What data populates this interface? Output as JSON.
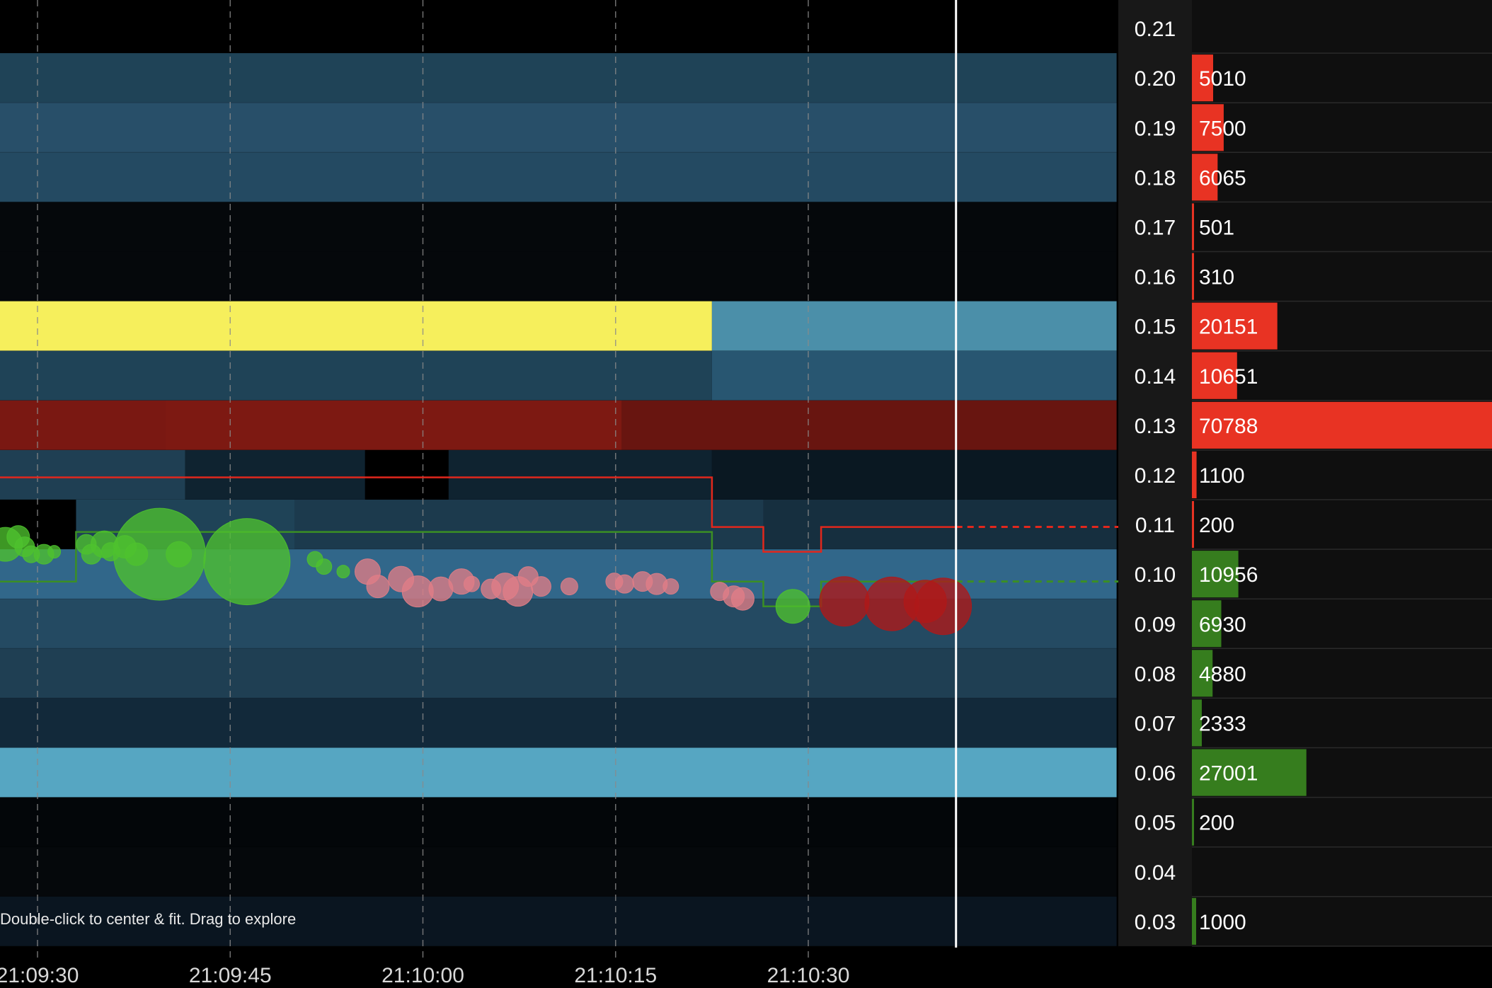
{
  "hint_text": "Double-click to center & fit. Drag to explore",
  "colors": {
    "background": "#000000",
    "price_column": "#181818",
    "volume_panel": "#0f0f0f",
    "ask_bar": "#e83323",
    "bid_bar": "#367d1e",
    "best_bid_line": "#3b8f24",
    "best_ask_line": "#e2271c",
    "buy_trade": "#4ec22e",
    "sell_trade": "#e07d86",
    "large_sell_trade": "#b01818",
    "grid": "#8a8a8a",
    "cursor_line": "#ffffff"
  },
  "chart_data": {
    "type": "heatmap",
    "title": "",
    "xlabel": "",
    "ylabel": "",
    "x_ticks": [
      "21:09:30",
      "21:09:45",
      "21:10:00",
      "21:10:15",
      "21:10:30"
    ],
    "x_tick_seconds": [
      0,
      15,
      30,
      45,
      60
    ],
    "xlim_seconds": [
      -3,
      84
    ],
    "cursor_seconds": 71.5,
    "price_levels": [
      0.21,
      0.2,
      0.19,
      0.18,
      0.17,
      0.16,
      0.15,
      0.14,
      0.13,
      0.12,
      0.11,
      0.1,
      0.09,
      0.08,
      0.07,
      0.06,
      0.05,
      0.04,
      0.03
    ],
    "price_labels": [
      "0.21",
      "0.20",
      "0.19",
      "0.18",
      "0.17",
      "0.16",
      "0.15",
      "0.14",
      "0.13",
      "0.12",
      "0.11",
      "0.10",
      "0.09",
      "0.08",
      "0.07",
      "0.06",
      "0.05",
      "0.04",
      "0.03"
    ],
    "depth_rows": [
      {
        "price": 0.21,
        "segments": []
      },
      {
        "price": 0.2,
        "segments": [
          {
            "from": -3,
            "to": 84,
            "color": "#1f4357"
          }
        ]
      },
      {
        "price": 0.19,
        "segments": [
          {
            "from": -3,
            "to": 84,
            "color": "#284f69"
          }
        ]
      },
      {
        "price": 0.18,
        "segments": [
          {
            "from": -3,
            "to": 84,
            "color": "#244a62"
          }
        ]
      },
      {
        "price": 0.17,
        "segments": [
          {
            "from": -3,
            "to": 84,
            "color": "#05080b"
          }
        ]
      },
      {
        "price": 0.16,
        "segments": [
          {
            "from": -3,
            "to": 84,
            "color": "#05080b"
          }
        ]
      },
      {
        "price": 0.15,
        "segments": [
          {
            "from": -3,
            "to": 52.5,
            "color": "#f6ef5c"
          },
          {
            "from": 52.5,
            "to": 84,
            "color": "#4b8fa9"
          }
        ]
      },
      {
        "price": 0.14,
        "segments": [
          {
            "from": -3,
            "to": 52.5,
            "color": "#1f4357"
          },
          {
            "from": 52.5,
            "to": 84,
            "color": "#285671"
          }
        ]
      },
      {
        "price": 0.13,
        "segments": [
          {
            "from": -3,
            "to": 10,
            "color": "#7a1812"
          },
          {
            "from": 10,
            "to": 45.5,
            "color": "#7d1912"
          },
          {
            "from": 45.5,
            "to": 84,
            "color": "#681510"
          }
        ]
      },
      {
        "price": 0.12,
        "segments": [
          {
            "from": -3,
            "to": 11.5,
            "color": "#1f3f53"
          },
          {
            "from": 11.5,
            "to": 25.5,
            "color": "#0f2330"
          },
          {
            "from": 25.5,
            "to": 32,
            "color": "#000000"
          },
          {
            "from": 32,
            "to": 52.5,
            "color": "#0f2330"
          },
          {
            "from": 52.5,
            "to": 84,
            "color": "#0a1822"
          }
        ]
      },
      {
        "price": 0.11,
        "segments": [
          {
            "from": -3,
            "to": 3,
            "color": "#000000"
          },
          {
            "from": 3,
            "to": 20,
            "color": "#1f4357"
          },
          {
            "from": 20,
            "to": 56.5,
            "color": "#1c3a4d"
          },
          {
            "from": 56.5,
            "to": 84,
            "color": "#162f3f"
          }
        ]
      },
      {
        "price": 0.1,
        "segments": [
          {
            "from": -3,
            "to": 84,
            "color": "#31678a"
          }
        ]
      },
      {
        "price": 0.09,
        "segments": [
          {
            "from": -3,
            "to": 84,
            "color": "#244a62"
          }
        ]
      },
      {
        "price": 0.08,
        "segments": [
          {
            "from": -3,
            "to": 84,
            "color": "#1f3f53"
          }
        ]
      },
      {
        "price": 0.07,
        "segments": [
          {
            "from": -3,
            "to": 84,
            "color": "#12293a"
          }
        ]
      },
      {
        "price": 0.06,
        "segments": [
          {
            "from": -3,
            "to": 84,
            "color": "#56a6c2"
          }
        ]
      },
      {
        "price": 0.05,
        "segments": [
          {
            "from": -3,
            "to": 84,
            "color": "#030609"
          }
        ]
      },
      {
        "price": 0.04,
        "segments": [
          {
            "from": -3,
            "to": 84,
            "color": "#05080b"
          }
        ]
      },
      {
        "price": 0.03,
        "segments": [
          {
            "from": -3,
            "to": 84,
            "color": "#0a1520"
          }
        ]
      }
    ],
    "best_ask": [
      [
        -3,
        0.1195
      ],
      [
        52.5,
        0.1195
      ],
      [
        52.5,
        0.1095
      ],
      [
        56.5,
        0.1095
      ],
      [
        56.5,
        0.1045
      ],
      [
        61,
        0.1045
      ],
      [
        61,
        0.1095
      ],
      [
        71.5,
        0.1095
      ]
    ],
    "best_bid": [
      [
        -3,
        0.0985
      ],
      [
        3,
        0.0985
      ],
      [
        3,
        0.1085
      ],
      [
        52.5,
        0.1085
      ],
      [
        52.5,
        0.0985
      ],
      [
        56.5,
        0.0985
      ],
      [
        56.5,
        0.0935
      ],
      [
        61,
        0.0935
      ],
      [
        61,
        0.0985
      ],
      [
        71.5,
        0.0985
      ]
    ],
    "trades": [
      {
        "t": -2.5,
        "price": 0.106,
        "size": 24,
        "side": "buy"
      },
      {
        "t": -1.5,
        "price": 0.1075,
        "size": 16,
        "side": "buy"
      },
      {
        "t": -1,
        "price": 0.1055,
        "size": 14,
        "side": "buy"
      },
      {
        "t": -0.5,
        "price": 0.104,
        "size": 12,
        "side": "buy"
      },
      {
        "t": 0.5,
        "price": 0.104,
        "size": 14,
        "side": "buy"
      },
      {
        "t": 1.3,
        "price": 0.1045,
        "size": 9,
        "side": "buy"
      },
      {
        "t": 3.8,
        "price": 0.106,
        "size": 14,
        "side": "buy"
      },
      {
        "t": 4.2,
        "price": 0.104,
        "size": 14,
        "side": "buy"
      },
      {
        "t": 5.2,
        "price": 0.106,
        "size": 19,
        "side": "buy"
      },
      {
        "t": 5.7,
        "price": 0.1045,
        "size": 13,
        "side": "buy"
      },
      {
        "t": 6.8,
        "price": 0.1055,
        "size": 16,
        "side": "buy"
      },
      {
        "t": 7.7,
        "price": 0.104,
        "size": 16,
        "side": "buy"
      },
      {
        "t": 9.5,
        "price": 0.104,
        "size": 65,
        "side": "buy"
      },
      {
        "t": 11,
        "price": 0.104,
        "size": 18,
        "side": "buy"
      },
      {
        "t": 16.3,
        "price": 0.1025,
        "size": 61,
        "side": "buy"
      },
      {
        "t": 21.6,
        "price": 0.103,
        "size": 11,
        "side": "buy"
      },
      {
        "t": 22.3,
        "price": 0.1015,
        "size": 11,
        "side": "buy"
      },
      {
        "t": 23.8,
        "price": 0.1005,
        "size": 9,
        "side": "buy"
      },
      {
        "t": 25.7,
        "price": 0.1005,
        "size": 18,
        "side": "sell"
      },
      {
        "t": 26.5,
        "price": 0.0975,
        "size": 16,
        "side": "sell"
      },
      {
        "t": 28.3,
        "price": 0.099,
        "size": 18,
        "side": "sell"
      },
      {
        "t": 29.6,
        "price": 0.0965,
        "size": 22,
        "side": "sell"
      },
      {
        "t": 31.4,
        "price": 0.097,
        "size": 17,
        "side": "sell"
      },
      {
        "t": 33,
        "price": 0.0985,
        "size": 18,
        "side": "sell"
      },
      {
        "t": 33.8,
        "price": 0.098,
        "size": 11,
        "side": "sell"
      },
      {
        "t": 35.3,
        "price": 0.097,
        "size": 14,
        "side": "sell"
      },
      {
        "t": 36.4,
        "price": 0.0975,
        "size": 19,
        "side": "sell"
      },
      {
        "t": 37.4,
        "price": 0.0965,
        "size": 21,
        "side": "sell"
      },
      {
        "t": 38.2,
        "price": 0.0995,
        "size": 14,
        "side": "sell"
      },
      {
        "t": 39.2,
        "price": 0.0975,
        "size": 14,
        "side": "sell"
      },
      {
        "t": 41.4,
        "price": 0.0975,
        "size": 12,
        "side": "sell"
      },
      {
        "t": 44.9,
        "price": 0.0985,
        "size": 12,
        "side": "sell"
      },
      {
        "t": 45.7,
        "price": 0.098,
        "size": 13,
        "side": "sell"
      },
      {
        "t": 47.1,
        "price": 0.0985,
        "size": 14,
        "side": "sell"
      },
      {
        "t": 48.2,
        "price": 0.098,
        "size": 15,
        "side": "sell"
      },
      {
        "t": 49.3,
        "price": 0.0975,
        "size": 11,
        "side": "sell"
      },
      {
        "t": 53.1,
        "price": 0.0965,
        "size": 13,
        "side": "sell"
      },
      {
        "t": 54.2,
        "price": 0.0955,
        "size": 15,
        "side": "sell"
      },
      {
        "t": 54.9,
        "price": 0.095,
        "size": 16,
        "side": "sell"
      },
      {
        "t": 58.8,
        "price": 0.0935,
        "size": 24,
        "side": "buy"
      },
      {
        "t": 62.8,
        "price": 0.0945,
        "size": 35,
        "side": "sell"
      },
      {
        "t": 66.5,
        "price": 0.094,
        "size": 38,
        "side": "sell"
      },
      {
        "t": 70.5,
        "price": 0.0935,
        "size": 40,
        "side": "sell"
      },
      {
        "t": 69.1,
        "price": 0.0945,
        "size": 30,
        "side": "sell"
      }
    ],
    "volume_profile": [
      {
        "price": 0.21,
        "value": null,
        "side": "ask"
      },
      {
        "price": 0.2,
        "value": 5010,
        "side": "ask"
      },
      {
        "price": 0.19,
        "value": 7500,
        "side": "ask"
      },
      {
        "price": 0.18,
        "value": 6065,
        "side": "ask"
      },
      {
        "price": 0.17,
        "value": 501,
        "side": "ask"
      },
      {
        "price": 0.16,
        "value": 310,
        "side": "ask"
      },
      {
        "price": 0.15,
        "value": 20151,
        "side": "ask"
      },
      {
        "price": 0.14,
        "value": 10651,
        "side": "ask"
      },
      {
        "price": 0.13,
        "value": 70788,
        "side": "ask"
      },
      {
        "price": 0.12,
        "value": 1100,
        "side": "ask"
      },
      {
        "price": 0.11,
        "value": 200,
        "side": "ask"
      },
      {
        "price": 0.1,
        "value": 10956,
        "side": "bid"
      },
      {
        "price": 0.09,
        "value": 6930,
        "side": "bid"
      },
      {
        "price": 0.08,
        "value": 4880,
        "side": "bid"
      },
      {
        "price": 0.07,
        "value": 2333,
        "side": "bid"
      },
      {
        "price": 0.06,
        "value": 27001,
        "side": "bid"
      },
      {
        "price": 0.05,
        "value": 200,
        "side": "bid"
      },
      {
        "price": 0.04,
        "value": null,
        "side": "bid"
      },
      {
        "price": 0.03,
        "value": 1000,
        "side": "bid"
      }
    ],
    "volume_max": 70788,
    "legend": "none",
    "grid": "vertical dashed at time ticks"
  }
}
